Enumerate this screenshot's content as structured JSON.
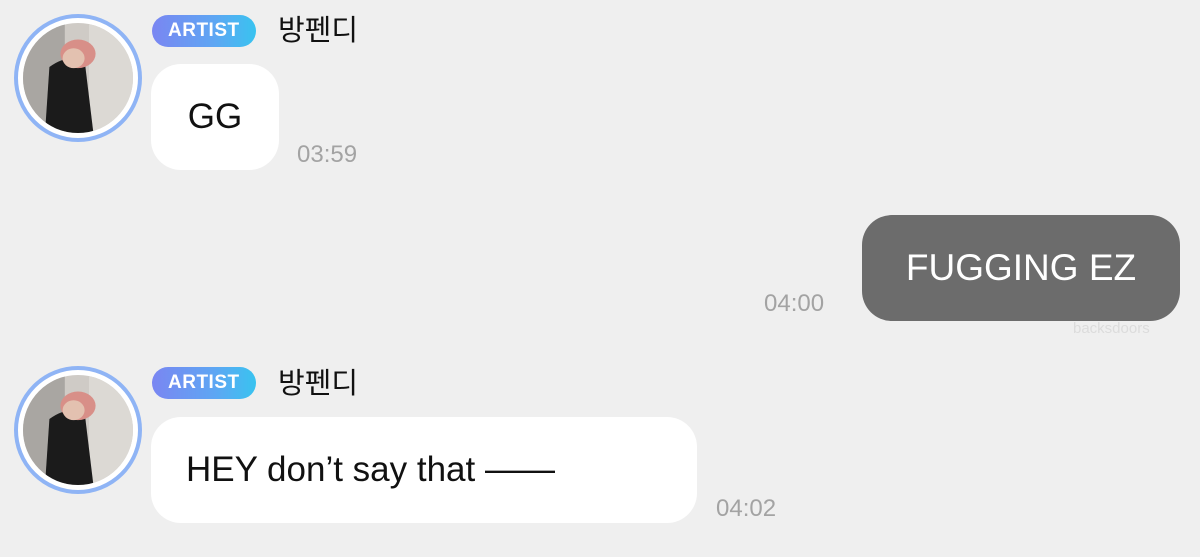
{
  "messages": [
    {
      "sender": {
        "badge": "ARTIST",
        "name": "방펜디"
      },
      "text": "GG",
      "time": "03:59"
    },
    {
      "outgoing": true,
      "text": "FUGGING EZ",
      "time": "04:00"
    },
    {
      "sender": {
        "badge": "ARTIST",
        "name": "방펜디"
      },
      "text": "HEY don’t say that  ——",
      "time": "04:02"
    }
  ],
  "watermark": "backsdoors",
  "colors": {
    "background": "#efefef",
    "incoming_bubble": "#ffffff",
    "outgoing_bubble": "#6c6c6c",
    "badge_gradient_start": "#7a86f2",
    "badge_gradient_end": "#39c3f0",
    "avatar_ring": "#8fb4f5",
    "timestamp": "#a3a3a3"
  },
  "icons": {
    "avatar": "artist-profile-photo"
  }
}
